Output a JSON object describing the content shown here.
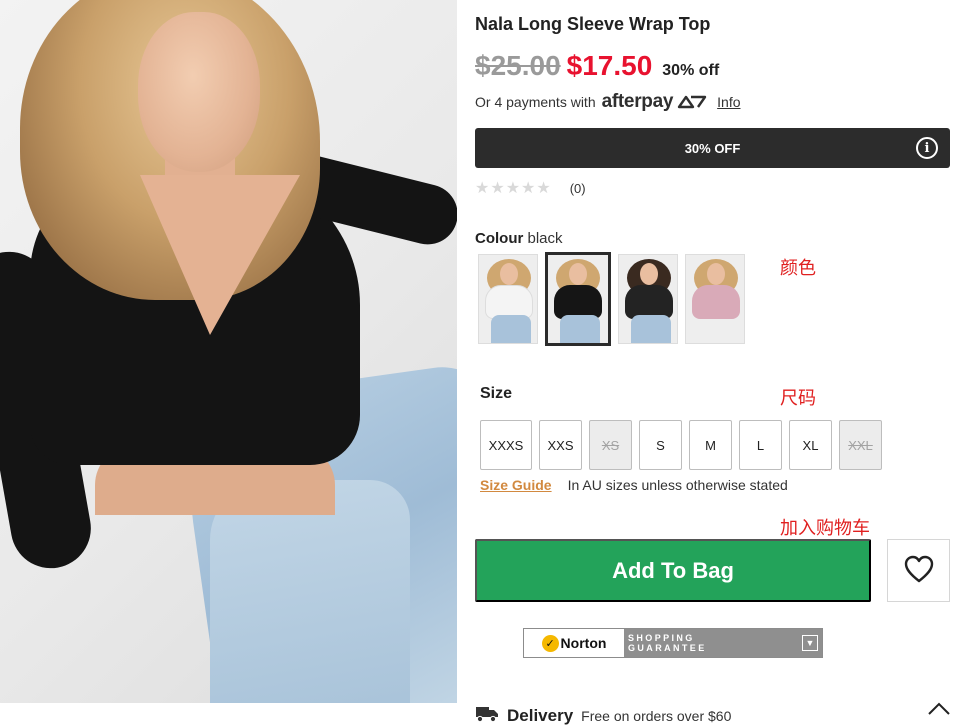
{
  "product": {
    "title": "Nala Long Sleeve Wrap Top",
    "price_was": "$25.00",
    "price_now": "$17.50",
    "discount_text": "30% off"
  },
  "afterpay": {
    "prefix": "Or 4 payments with",
    "logo": "afterpay",
    "info_link": "Info"
  },
  "promo": {
    "label": "30% OFF",
    "info_icon": "i"
  },
  "rating": {
    "stars": "★★★★★",
    "count": "(0)"
  },
  "colour": {
    "label": "Colour",
    "selected": "black",
    "swatches": [
      {
        "name": "white",
        "top_color": "#f4f4f4"
      },
      {
        "name": "black",
        "top_color": "#151515"
      },
      {
        "name": "black-print",
        "top_color": "#232323"
      },
      {
        "name": "pink",
        "top_color": "#d9aab8"
      }
    ]
  },
  "size": {
    "label": "Size",
    "options": [
      {
        "label": "XXXS",
        "available": true
      },
      {
        "label": "XXS",
        "available": true
      },
      {
        "label": "XS",
        "available": false
      },
      {
        "label": "S",
        "available": true
      },
      {
        "label": "M",
        "available": true
      },
      {
        "label": "L",
        "available": true
      },
      {
        "label": "XL",
        "available": true
      },
      {
        "label": "XXL",
        "available": false
      }
    ],
    "guide_link": "Size Guide",
    "note": "In AU sizes unless otherwise stated"
  },
  "annotations": {
    "colour": "颜色",
    "size": "尺码",
    "add_to_bag": "加入购物车"
  },
  "cart": {
    "add_to_bag": "Add To Bag"
  },
  "norton": {
    "brand": "Norton",
    "line1": "SHOPPING",
    "line2": "GUARANTEE"
  },
  "delivery": {
    "title": "Delivery",
    "note": "Free on orders over $60"
  },
  "colors": {
    "price_now": "#e8122f",
    "add_to_bag": "#23a35a",
    "promo_bar": "#2c2c2c",
    "size_guide": "#d2893f",
    "annotation": "#e02020"
  },
  "icons": [
    "info-icon",
    "heart-icon",
    "truck-icon",
    "chevron-up-icon",
    "norton-check-icon",
    "chevron-down-icon"
  ]
}
